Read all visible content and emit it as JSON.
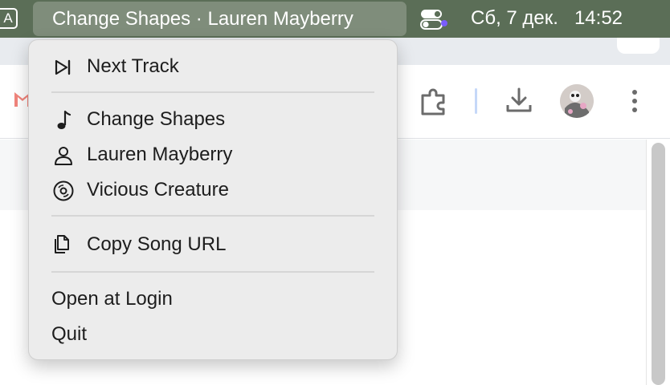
{
  "menubar": {
    "input_source": "A",
    "now_playing_title": "Change Shapes · Lauren Mayberry",
    "date": "Сб, 7 дек.",
    "time": "14:52",
    "background_color": "#5b6e57",
    "control_center_icon": "toggle-switch-icon"
  },
  "browser": {
    "toolbar_icons": [
      "gmail-icon",
      "extensions-puzzle-icon",
      "download-icon",
      "profile-avatar",
      "more-vert-icon"
    ]
  },
  "menu": {
    "items": [
      {
        "label": "Next Track",
        "icon": "next-track-icon"
      },
      {
        "label": "Change Shapes",
        "icon": "music-note-icon"
      },
      {
        "label": "Lauren Mayberry",
        "icon": "person-icon"
      },
      {
        "label": "Vicious Creature",
        "icon": "album-disc-icon"
      },
      {
        "label": "Copy Song URL",
        "icon": "copy-documents-icon"
      },
      {
        "label": "Open at Login",
        "icon": ""
      },
      {
        "label": "Quit",
        "icon": ""
      }
    ]
  }
}
